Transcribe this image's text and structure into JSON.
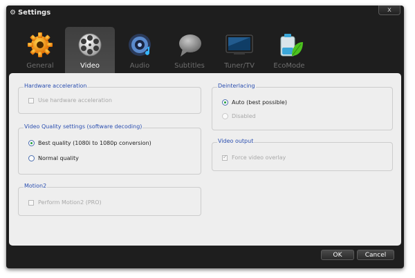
{
  "window": {
    "title": "Settings",
    "close_label": "x"
  },
  "tabs": [
    {
      "label": "General",
      "icon": "gear-icon",
      "active": false
    },
    {
      "label": "Video",
      "icon": "film-reel-icon",
      "active": true
    },
    {
      "label": "Audio",
      "icon": "speaker-icon",
      "active": false
    },
    {
      "label": "Subtitles",
      "icon": "speech-bubble-icon",
      "active": false
    },
    {
      "label": "Tuner/TV",
      "icon": "tv-icon",
      "active": false
    },
    {
      "label": "EcoMode",
      "icon": "battery-leaf-icon",
      "active": false
    }
  ],
  "hardware": {
    "title": "Hardware acceleration",
    "option": "Use hardware acceleration",
    "checked": false,
    "enabled": false
  },
  "quality": {
    "title": "Video Quality settings (software decoding)",
    "options": [
      {
        "label": "Best quality (1080i to 1080p conversion)",
        "selected": true
      },
      {
        "label": "Normal quality",
        "selected": false
      }
    ]
  },
  "motion": {
    "title": "Motion2",
    "option": "Perform Motion2 (PRO)",
    "checked": false,
    "enabled": false
  },
  "deinterlacing": {
    "title": "Deinterlacing",
    "options": [
      {
        "label": "Auto (best possible)",
        "selected": true,
        "enabled": true
      },
      {
        "label": "Disabled",
        "selected": false,
        "enabled": false
      }
    ]
  },
  "video_output": {
    "title": "Video output",
    "option": "Force video overlay",
    "checked": true,
    "enabled": false
  },
  "footer": {
    "ok_label": "OK",
    "cancel_label": "Cancel"
  },
  "colors": {
    "window_bg": "#1e1e1e",
    "panel_bg": "#eeeeee",
    "group_title": "#2b4fb0",
    "radio_dot": "#1f9d3a"
  }
}
